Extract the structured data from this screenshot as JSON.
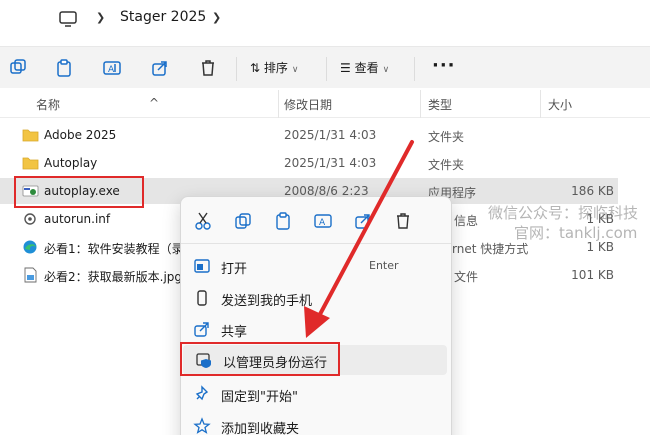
{
  "address": {
    "crumb": "Stager 2025"
  },
  "toolbar": {
    "sort_label": "排序",
    "view_label": "查看",
    "more": "···"
  },
  "columns": {
    "name": "名称",
    "date": "修改日期",
    "type": "类型",
    "size": "大小"
  },
  "rows": [
    {
      "name": "Adobe 2025",
      "date": "2025/1/31 4:03",
      "type": "文件夹",
      "size": ""
    },
    {
      "name": "Autoplay",
      "date": "2025/1/31 4:03",
      "type": "文件夹",
      "size": ""
    },
    {
      "name": "autoplay.exe",
      "date": "2008/8/6 2:23",
      "type": "应用程序",
      "size": "186 KB"
    },
    {
      "name": "autorun.inf",
      "date": "",
      "type": "信息",
      "size": "1 KB"
    },
    {
      "name": "必看1：软件安装教程（录",
      "date": "",
      "type": "rnet 快捷方式",
      "size": "1 KB"
    },
    {
      "name": "必看2：获取最新版本.jpg",
      "date": "",
      "type": "文件",
      "size": "101 KB"
    }
  ],
  "context_menu": {
    "items": [
      {
        "label": "打开",
        "shortcut": "Enter"
      },
      {
        "label": "发送到我的手机"
      },
      {
        "label": "共享"
      },
      {
        "label": "以管理员身份运行"
      },
      {
        "label": "固定到\"开始\""
      },
      {
        "label": "添加到收藏夹"
      }
    ]
  },
  "watermark": {
    "line1": "微信公众号：探临科技",
    "line2": "官网：tanklj.com"
  },
  "colors": {
    "highlight": "#e02a2a",
    "folder": "#f2c443",
    "accent": "#1a6fc9"
  }
}
